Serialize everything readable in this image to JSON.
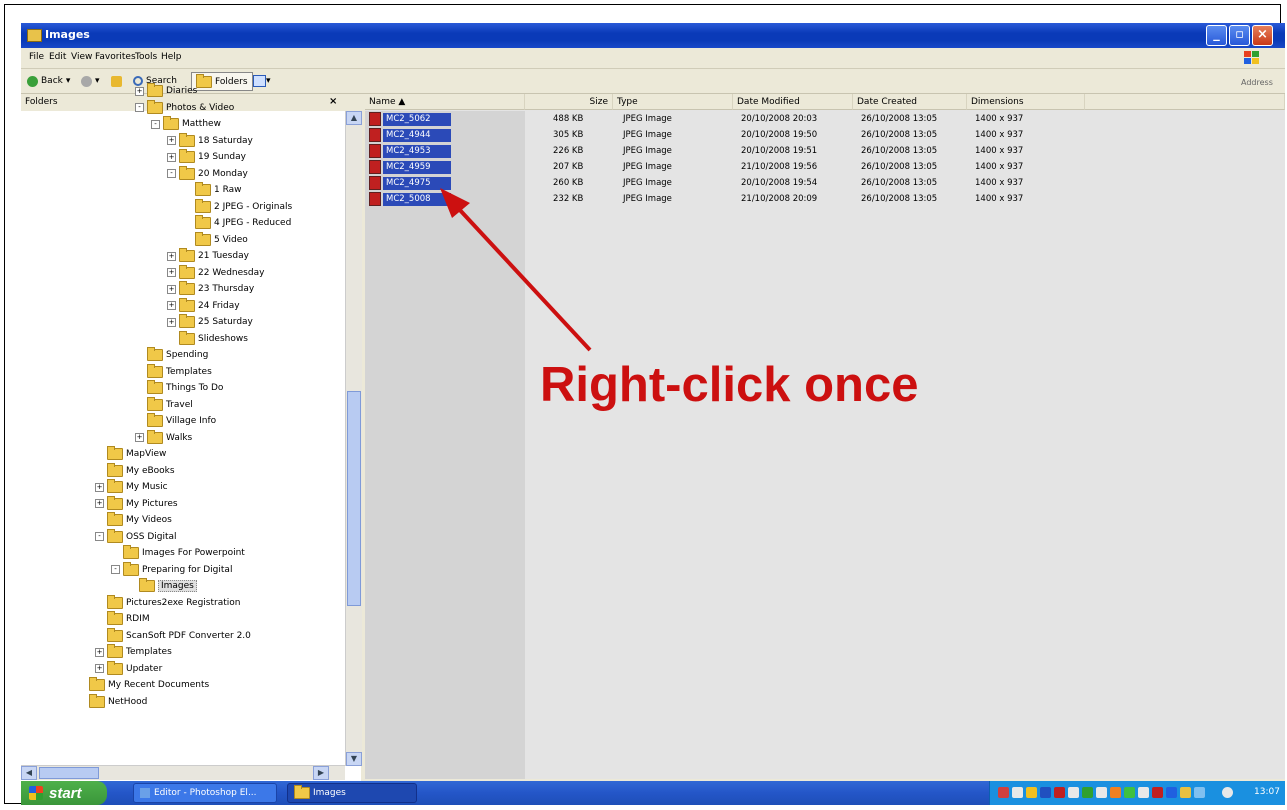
{
  "window": {
    "title": "Images"
  },
  "menu": [
    "File",
    "Edit",
    "View",
    "Favorites",
    "Tools",
    "Help"
  ],
  "toolbar": {
    "back": "Back",
    "search": "Search",
    "folders": "Folders",
    "address": "Address"
  },
  "folders_pane": {
    "title": "Folders",
    "close": "×",
    "tree": [
      {
        "label": "Diaries",
        "expander": "+"
      },
      {
        "label": "Photos & Video",
        "expander": "-"
      },
      {
        "label": "Matthew",
        "expander": "-"
      },
      {
        "label": "18 Saturday",
        "expander": "+"
      },
      {
        "label": "19 Sunday",
        "expander": "+"
      },
      {
        "label": "20 Monday",
        "expander": "-"
      },
      {
        "label": "1 Raw",
        "expander": ""
      },
      {
        "label": "2 JPEG - Originals",
        "expander": ""
      },
      {
        "label": "4 JPEG - Reduced",
        "expander": ""
      },
      {
        "label": "5 Video",
        "expander": ""
      },
      {
        "label": "21 Tuesday",
        "expander": "+"
      },
      {
        "label": "22 Wednesday",
        "expander": "+"
      },
      {
        "label": "23 Thursday",
        "expander": "+"
      },
      {
        "label": "24 Friday",
        "expander": "+"
      },
      {
        "label": "25 Saturday",
        "expander": "+"
      },
      {
        "label": "Slideshows",
        "expander": ""
      },
      {
        "label": "Spending",
        "expander": ""
      },
      {
        "label": "Templates",
        "expander": ""
      },
      {
        "label": "Things To Do",
        "expander": ""
      },
      {
        "label": "Travel",
        "expander": ""
      },
      {
        "label": "Village Info",
        "expander": ""
      },
      {
        "label": "Walks",
        "expander": "+"
      },
      {
        "label": "MapView",
        "expander": ""
      },
      {
        "label": "My eBooks",
        "expander": ""
      },
      {
        "label": "My Music",
        "expander": "+"
      },
      {
        "label": "My Pictures",
        "expander": "+"
      },
      {
        "label": "My Videos",
        "expander": ""
      },
      {
        "label": "OSS Digital",
        "expander": "-"
      },
      {
        "label": "Images For Powerpoint",
        "expander": ""
      },
      {
        "label": "Preparing for Digital",
        "expander": "-"
      },
      {
        "label": "Images",
        "expander": ""
      },
      {
        "label": "Pictures2exe Registration",
        "expander": ""
      },
      {
        "label": "RDIM",
        "expander": ""
      },
      {
        "label": "ScanSoft PDF Converter 2.0",
        "expander": ""
      },
      {
        "label": "Templates",
        "expander": "+"
      },
      {
        "label": "Updater",
        "expander": "+"
      },
      {
        "label": "My Recent Documents",
        "expander": ""
      },
      {
        "label": "NetHood",
        "expander": ""
      }
    ]
  },
  "file_list": {
    "columns": [
      "Name",
      "Size",
      "Type",
      "Date Modified",
      "Date Created",
      "Dimensions"
    ],
    "rows": [
      {
        "name": "MC2_5062",
        "size": "488 KB",
        "type": "JPEG Image",
        "modified": "20/10/2008 20:03",
        "created": "26/10/2008 13:05",
        "dimensions": "1400 x 937"
      },
      {
        "name": "MC2_4944",
        "size": "305 KB",
        "type": "JPEG Image",
        "modified": "20/10/2008 19:50",
        "created": "26/10/2008 13:05",
        "dimensions": "1400 x 937"
      },
      {
        "name": "MC2_4953",
        "size": "226 KB",
        "type": "JPEG Image",
        "modified": "20/10/2008 19:51",
        "created": "26/10/2008 13:05",
        "dimensions": "1400 x 937"
      },
      {
        "name": "MC2_4959",
        "size": "207 KB",
        "type": "JPEG Image",
        "modified": "21/10/2008 19:56",
        "created": "26/10/2008 13:05",
        "dimensions": "1400 x 937"
      },
      {
        "name": "MC2_4975",
        "size": "260 KB",
        "type": "JPEG Image",
        "modified": "20/10/2008 19:54",
        "created": "26/10/2008 13:05",
        "dimensions": "1400 x 937"
      },
      {
        "name": "MC2_5008",
        "size": "232 KB",
        "type": "JPEG Image",
        "modified": "21/10/2008 20:09",
        "created": "26/10/2008 13:05",
        "dimensions": "1400 x 937"
      }
    ]
  },
  "annotation": {
    "text": "Right-click once",
    "color": "#cc1010"
  },
  "taskbar": {
    "start": "start",
    "tasks": [
      "Editor - Photoshop El...",
      "Images"
    ],
    "clock": "13:07"
  }
}
